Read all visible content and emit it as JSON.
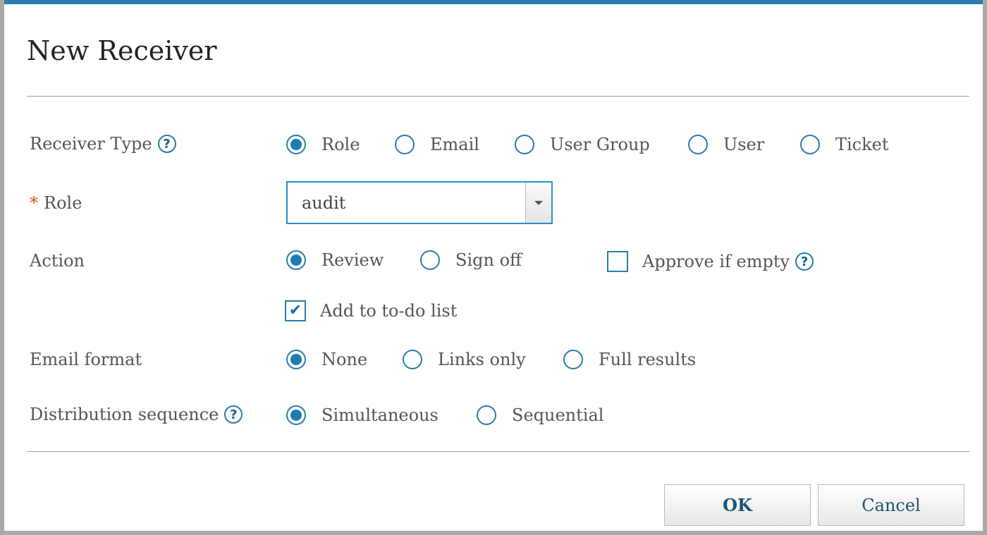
{
  "dialog": {
    "title": "New Receiver",
    "ok_label": "OK",
    "cancel_label": "Cancel"
  },
  "receiver_type": {
    "label": "Receiver Type",
    "options": [
      "Role",
      "Email",
      "User Group",
      "User",
      "Ticket"
    ],
    "selected": "Role"
  },
  "role": {
    "required_marker": "*",
    "label": "Role",
    "value": "audit"
  },
  "action": {
    "label": "Action",
    "options": [
      "Review",
      "Sign off"
    ],
    "selected": "Review",
    "approve_if_empty_label": "Approve if empty",
    "approve_if_empty_checked": false,
    "add_to_todo_label": "Add to to-do list",
    "add_to_todo_checked": true
  },
  "email_format": {
    "label": "Email format",
    "options": [
      "None",
      "Links only",
      "Full results"
    ],
    "selected": "None"
  },
  "distribution_sequence": {
    "label": "Distribution sequence",
    "options": [
      "Simultaneous",
      "Sequential"
    ],
    "selected": "Simultaneous"
  },
  "help_icon_glyph": "?",
  "check_glyph": "✔",
  "colors": {
    "accent": "#2a7da8",
    "radio_fill": "#1c7bb1",
    "required": "#d9531e"
  }
}
